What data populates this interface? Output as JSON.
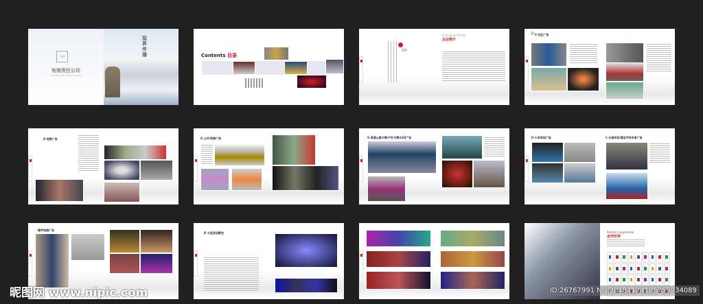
{
  "cover": {
    "brand_vertical": "猿界传播",
    "qr_label": "二维码",
    "company": "有限责任公司",
    "company_en": "Company with limited liability"
  },
  "contents": {
    "title": "Contents",
    "title_cn": "目录"
  },
  "profile": {
    "en": "Enterprise Profile",
    "cn": "企业简介",
    "side_mark": "企业"
  },
  "pages": [
    {
      "letter": "S",
      "title": "社区广告"
    },
    {
      "letter": "D",
      "title": "地铁广告"
    },
    {
      "letter": "G",
      "title": "公交/地铁广告"
    },
    {
      "letter": "G",
      "title": "高速公路大牌/户外大牌/LED广告"
    },
    {
      "letter": "H",
      "title": "火车车站广告"
    },
    {
      "letter": "C",
      "title": "长途车站/客运汽车车身广告"
    },
    {
      "letter": "",
      "title": "楼宇电梯广告"
    },
    {
      "letter": "D",
      "title": "大型活动策划"
    }
  ],
  "partner": {
    "en": "Partner Corporation",
    "cn": "合作伙伴"
  },
  "watermark": {
    "site": "昵图网 www.nipic.com",
    "id": "ID:26767991 NO:20181124185759934089"
  },
  "colors": {
    "background": "#221f20",
    "accent": "#c8202a"
  }
}
